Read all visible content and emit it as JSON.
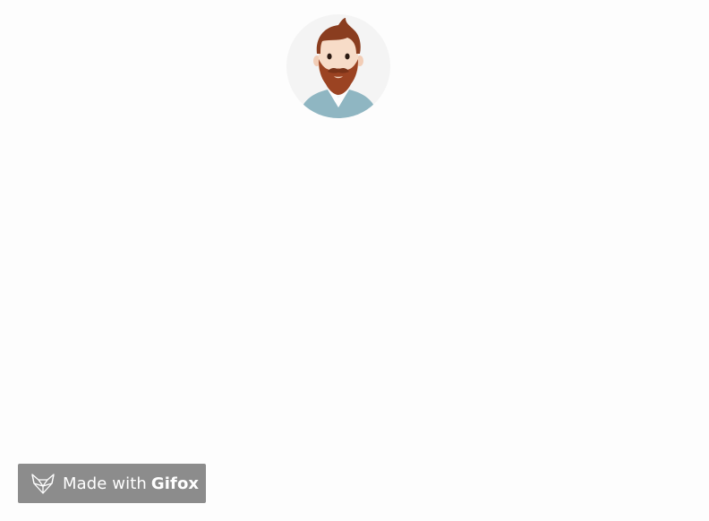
{
  "avatar": {
    "icon": "bearded-man-avatar",
    "colors": {
      "circle_bg": "#f4f4f4",
      "hair": "#8a3d1f",
      "beard": "#9b4322",
      "skin": "#f7dcc8",
      "shirt": "#8fb6c2"
    }
  },
  "badge": {
    "prefix": "Made with",
    "brand": "Gifox",
    "icon": "fox-logo-icon",
    "background": "#8c8c8c"
  }
}
